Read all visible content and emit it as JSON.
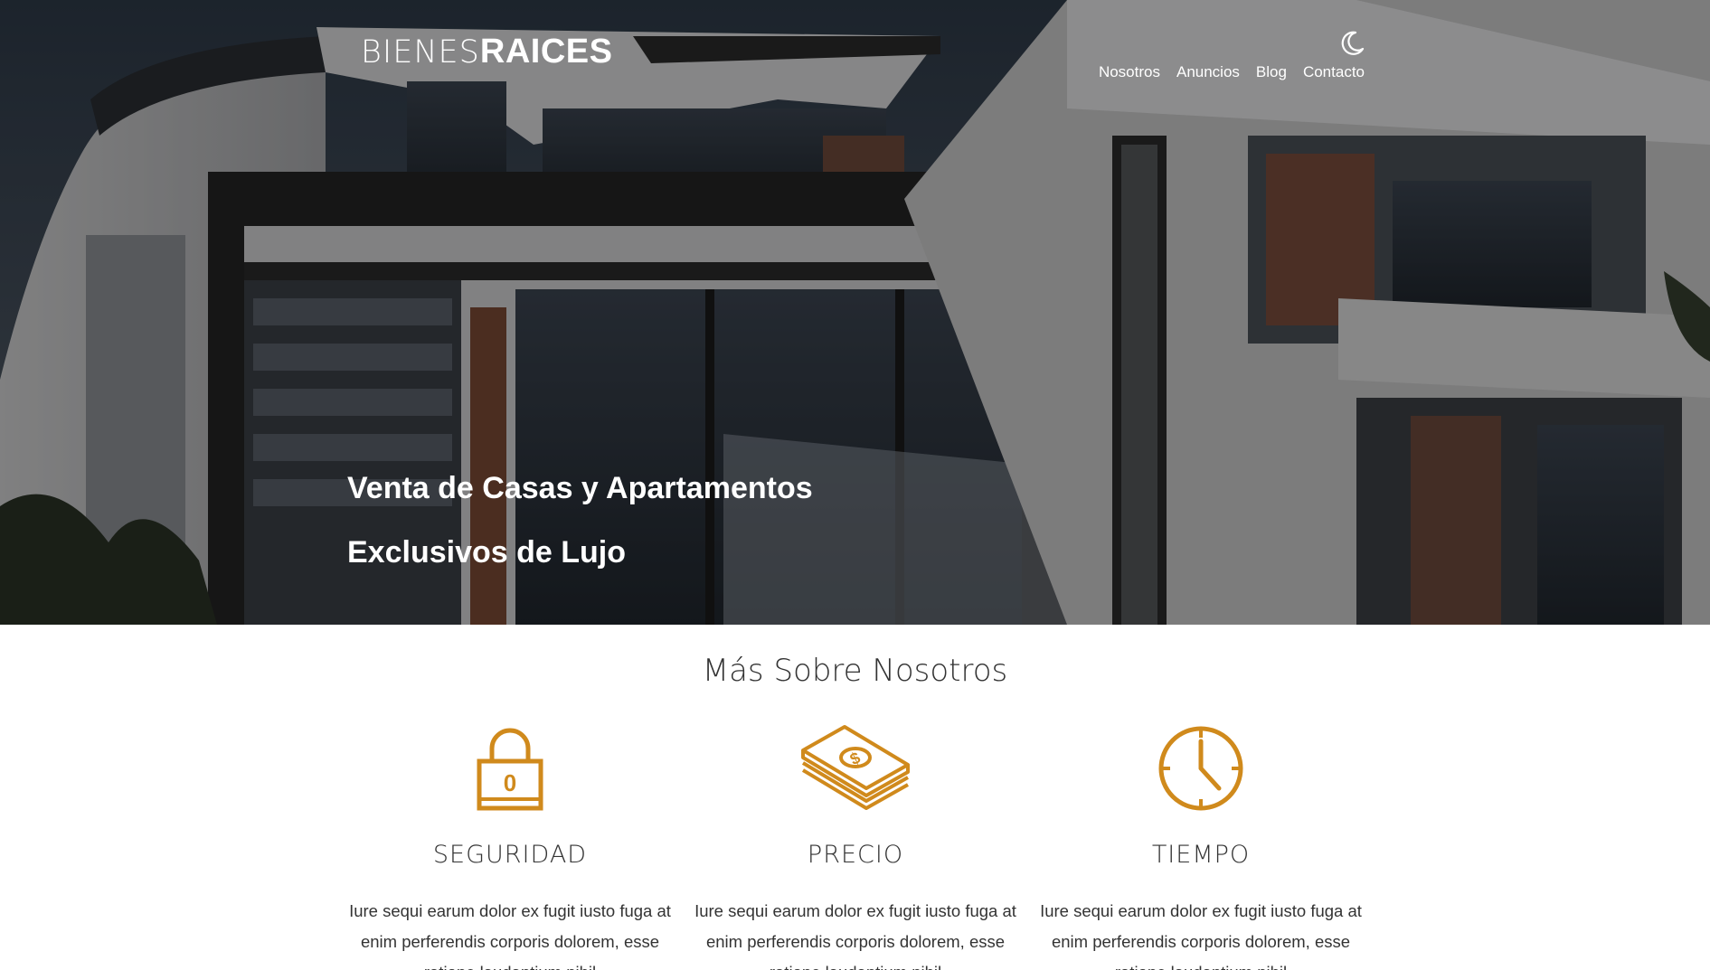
{
  "header": {
    "logo_light": "BIENES",
    "logo_bold": "RAICES",
    "nav": [
      {
        "label": "Nosotros"
      },
      {
        "label": "Anuncios"
      },
      {
        "label": "Blog"
      },
      {
        "label": "Contacto"
      }
    ],
    "dark_mode_icon": "moon-icon"
  },
  "hero": {
    "title": "Venta de Casas y Apartamentos Exclusivos de Lujo"
  },
  "about": {
    "title": "Más Sobre Nosotros",
    "features": [
      {
        "icon": "lock-icon",
        "title": "SEGURIDAD",
        "text": "Iure sequi earum dolor ex fugit iusto fuga at enim perferendis corporis dolorem, esse ratione laudantium nihil"
      },
      {
        "icon": "money-icon",
        "title": "PRECIO",
        "text": "Iure sequi earum dolor ex fugit iusto fuga at enim perferendis corporis dolorem, esse ratione laudantium nihil"
      },
      {
        "icon": "clock-icon",
        "title": "TIEMPO",
        "text": "Iure sequi earum dolor ex fugit iusto fuga at enim perferendis corporis dolorem, esse ratione laudantium nihil"
      }
    ]
  },
  "colors": {
    "accent": "#d08a1c",
    "text": "#333333",
    "white": "#ffffff"
  }
}
